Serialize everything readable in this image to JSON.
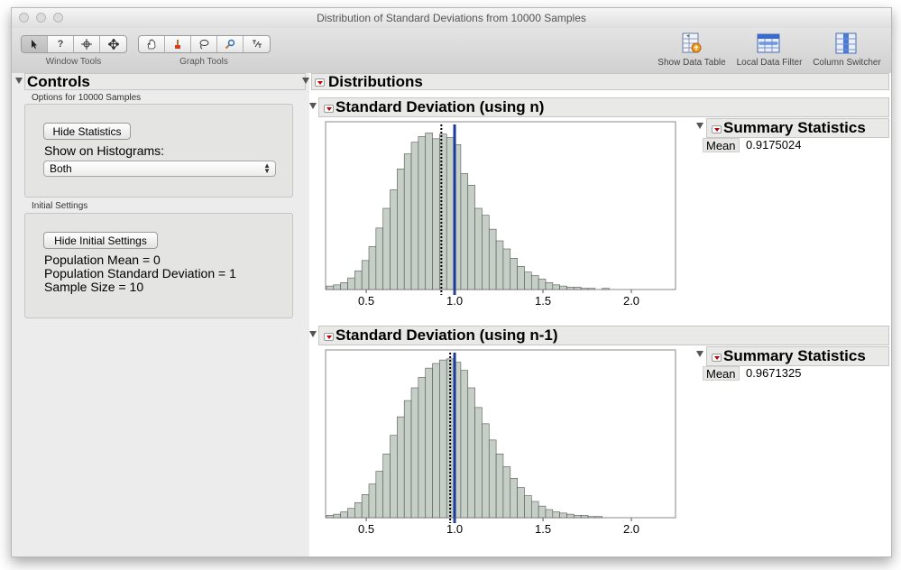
{
  "window": {
    "title": "Distribution of Standard Deviations from 10000 Samples"
  },
  "toolbar": {
    "window_tools_label": "Window Tools",
    "graph_tools_label": "Graph Tools",
    "window_tools": [
      "arrow-icon",
      "help-icon",
      "crosshair-icon",
      "move-icon"
    ],
    "graph_tools": [
      "hand-icon",
      "brush-icon",
      "lasso-icon",
      "magnifier-icon",
      "annotate-icon"
    ],
    "show_data_table": "Show Data Table",
    "local_data_filter": "Local Data Filter",
    "column_switcher": "Column Switcher"
  },
  "controls": {
    "title": "Controls",
    "options_label": "Options for 10000 Samples",
    "hide_statistics": "Hide Statistics",
    "show_on_histograms": "Show on Histograms:",
    "histogram_option": "Both",
    "initial_settings_label": "Initial Settings",
    "hide_initial_settings": "Hide Initial Settings",
    "population_mean": "Population Mean = 0",
    "population_sd": "Population Standard Deviation = 1",
    "sample_size": "Sample Size = 10"
  },
  "distributions": {
    "title": "Distributions",
    "sections": [
      {
        "title": "Standard Deviation (using n)",
        "summary_title": "Summary Statistics",
        "mean_label": "Mean",
        "mean_value": "0.9175024"
      },
      {
        "title": "Standard Deviation (using n-1)",
        "summary_title": "Summary Statistics",
        "mean_label": "Mean",
        "mean_value": "0.9671325"
      }
    ]
  },
  "colors": {
    "bar": "#c5cfc5",
    "bar_stroke": "#555555",
    "mean_line": "#1a3a9c",
    "accent_red": "#c00000"
  },
  "chart_data": [
    {
      "type": "bar",
      "xlim": [
        0.27,
        2.25
      ],
      "tick_labels": [
        "0.5",
        "1.0",
        "1.5",
        "2.0"
      ],
      "tick_values": [
        0.5,
        1.0,
        1.5,
        2.0
      ],
      "bin_start": 0.275,
      "bin_width": 0.04,
      "values": [
        3,
        4,
        6,
        10,
        16,
        25,
        37,
        53,
        70,
        86,
        104,
        117,
        127,
        132,
        135,
        130,
        134,
        131,
        125,
        100,
        90,
        70,
        64,
        52,
        42,
        35,
        27,
        20,
        15,
        12,
        9,
        6,
        4,
        3,
        2,
        2,
        1,
        1,
        0,
        1
      ],
      "reference_lines": [
        {
          "x": 0.925,
          "style": "dotted"
        },
        {
          "x": 1.0,
          "style": "solid"
        }
      ]
    },
    {
      "type": "bar",
      "xlim": [
        0.27,
        2.25
      ],
      "tick_labels": [
        "0.5",
        "1.0",
        "1.5",
        "2.0"
      ],
      "tick_values": [
        0.5,
        1.0,
        1.5,
        2.0
      ],
      "bin_start": 0.275,
      "bin_width": 0.04,
      "values": [
        2,
        3,
        5,
        8,
        13,
        20,
        29,
        40,
        55,
        71,
        87,
        101,
        112,
        121,
        129,
        133,
        136,
        137,
        134,
        127,
        112,
        95,
        81,
        67,
        55,
        44,
        34,
        26,
        19,
        14,
        10,
        7,
        5,
        4,
        3,
        2,
        2,
        1,
        1,
        0
      ],
      "reference_lines": [
        {
          "x": 0.975,
          "style": "dotted"
        },
        {
          "x": 1.0,
          "style": "solid"
        }
      ]
    }
  ]
}
